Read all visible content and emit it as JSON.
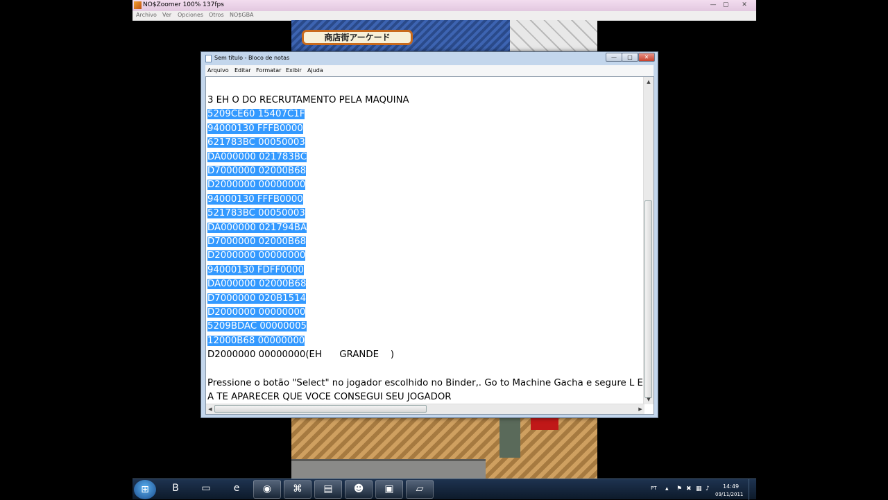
{
  "emulator": {
    "title": "NO$Zoomer 100% 137fps",
    "menu": [
      "Archivo",
      "Ver",
      "Opciones",
      "Otros",
      "NO$GBA"
    ],
    "controls": {
      "minimize": "—",
      "maximize": "▢",
      "close": "✕"
    }
  },
  "game": {
    "banner_text": "商店街アーケード"
  },
  "notepad": {
    "title": "Sem título - Bloco de notas",
    "menu": [
      "Arquivo",
      "Editar",
      "Formatar",
      "Exibir",
      "Ajuda"
    ],
    "controls": {
      "minimize": "—",
      "maximize": "□",
      "close": "✕"
    },
    "lines": [
      {
        "text": "3 EH O DO RECRUTAMENTO PELA MAQUINA",
        "selected": false
      },
      {
        "text": "5209CE60 15407C1F",
        "selected": true
      },
      {
        "text": "94000130 FFFB0000",
        "selected": true
      },
      {
        "text": "621783BC 00050003",
        "selected": true
      },
      {
        "text": "DA000000 021783BC",
        "selected": true
      },
      {
        "text": "D7000000 02000B68",
        "selected": true
      },
      {
        "text": "D2000000 00000000",
        "selected": true
      },
      {
        "text": "94000130 FFFB0000",
        "selected": true
      },
      {
        "text": "521783BC 00050003",
        "selected": true
      },
      {
        "text": "DA000000 021794BA",
        "selected": true
      },
      {
        "text": "D7000000 02000B68",
        "selected": true
      },
      {
        "text": "D2000000 00000000",
        "selected": true
      },
      {
        "text": "94000130 FDFF0000",
        "selected": true
      },
      {
        "text": "DA000000 02000B68",
        "selected": true
      },
      {
        "text": "D7000000 020B1514",
        "selected": true
      },
      {
        "text": "D2000000 00000000",
        "selected": true
      },
      {
        "text": "5209BDAC 00000005",
        "selected": true
      },
      {
        "text": "12000B68 00000000",
        "selected": true
      },
      {
        "text": "D2000000 00000000(EH      GRANDE    )",
        "selected": false
      },
      {
        "text": "",
        "selected": false
      },
      {
        "text": "Pressione o botão \"Select\" no jogador escolhido no Binder,. Go to Machine Gacha e segure L E",
        "selected": false
      },
      {
        "text": "A TE APARECER QUE VOCE CONSEGUI SEU JOGADOR",
        "selected": false
      }
    ]
  },
  "taskbar": {
    "start_icon": "windows-logo-icon",
    "apps": [
      "ie-like-b-icon",
      "folder-icon",
      "internet-explorer-icon",
      "chrome-icon",
      "network-app-icon",
      "notepad-app-icon",
      "game-character-icon",
      "tool-app-icon",
      "notepad-icon"
    ],
    "tray": {
      "language": "PT",
      "time": "14:49",
      "date": "09/11/2011"
    }
  }
}
